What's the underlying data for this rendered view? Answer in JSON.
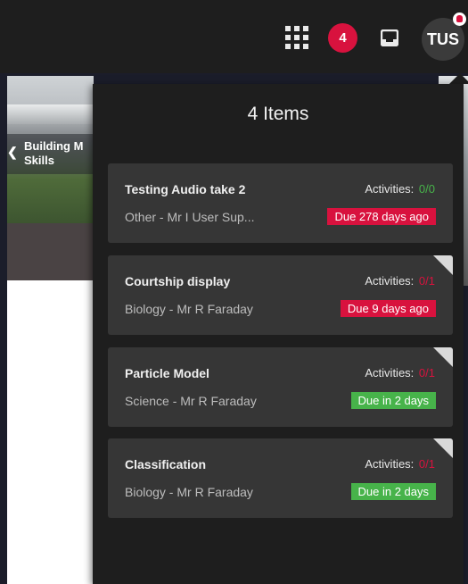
{
  "topbar": {
    "notification_count": "4",
    "avatar_initials": "TUS"
  },
  "background": {
    "course_title": "Building M\nSkills"
  },
  "panel": {
    "title": "4 Items",
    "items": [
      {
        "title": "Testing Audio take 2",
        "subtitle": "Other - Mr I User Sup...",
        "activities_label": "Activities:",
        "activities_count": "0/0",
        "activities_color": "#47b34a",
        "due": "Due 278 days ago",
        "due_status": "overdue",
        "new": false
      },
      {
        "title": "Courtship display",
        "subtitle": "Biology - Mr R Faraday",
        "activities_label": "Activities:",
        "activities_count": "0/1",
        "activities_color": "#d8123e",
        "due": "Due 9 days ago",
        "due_status": "overdue",
        "new": true
      },
      {
        "title": "Particle Model",
        "subtitle": "Science - Mr R Faraday",
        "activities_label": "Activities:",
        "activities_count": "0/1",
        "activities_color": "#d8123e",
        "due": "Due in 2 days",
        "due_status": "upcoming",
        "new": true
      },
      {
        "title": "Classification",
        "subtitle": "Biology - Mr R Faraday",
        "activities_label": "Activities:",
        "activities_count": "0/1",
        "activities_color": "#d8123e",
        "due": "Due in 2 days",
        "due_status": "upcoming",
        "new": true
      }
    ]
  },
  "colors": {
    "overdue": "#d8123e",
    "upcoming": "#47b34a",
    "panel_bg": "#1e1e1e",
    "card_bg": "#363636"
  },
  "icons": [
    "apps-grid-icon",
    "inbox-icon",
    "avatar-alert-icon",
    "chevron-left-icon"
  ]
}
